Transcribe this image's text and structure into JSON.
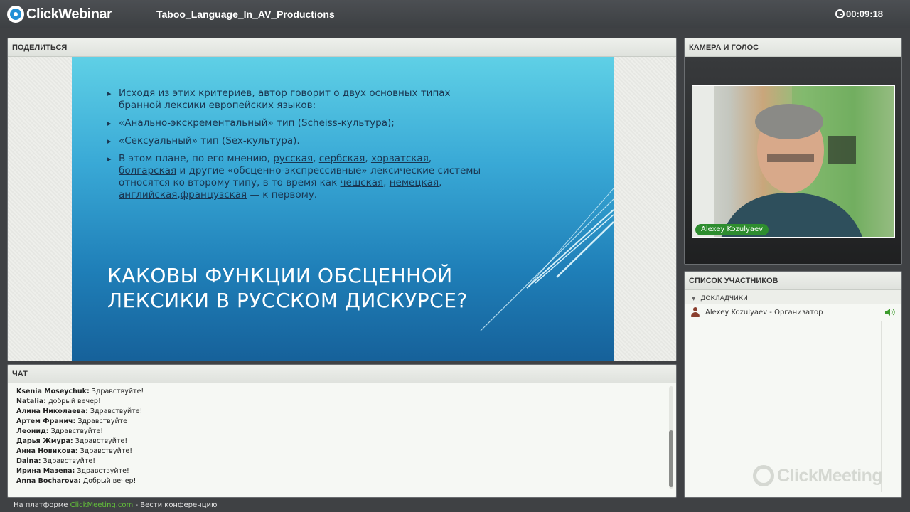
{
  "app": {
    "logo": "ClickWebinar",
    "title": "Taboo_Language_In_AV_Productions",
    "timer": "00:09:18"
  },
  "share": {
    "header": "ПОДЕЛИТЬСЯ",
    "slide": {
      "bullet1": "Исходя из этих критериев, автор говорит о двух основных типах бранной лексики европейских языков:",
      "bullet2": "«Анально-экскрементальный» тип (Scheiss-культура);",
      "bullet3": "«Сексуальный» тип (Sex-культура).",
      "bullet4": {
        "t1": "В этом плане, по его мнению, ",
        "link1": "русская",
        "sep1": ", ",
        "link2": "сербская",
        "sep2": ", ",
        "link3": "хорватская",
        "sep3": ", ",
        "link4": "болгарская",
        "t2": " и другие «обсценно-экспрессивные» лексические системы относятся ко второму типу, в то время как ",
        "link5": "чешская",
        "sep4": ", ",
        "link6": "немецкая",
        "sep5": ", ",
        "link7": "английская",
        "sep6": ",",
        "link8": "французская",
        "t3": " — к первому."
      },
      "heading": "КАКОВЫ ФУНКЦИИ ОБСЦЕННОЙ ЛЕКСИКИ В РУССКОМ ДИСКУРСЕ?"
    }
  },
  "camera": {
    "header": "КАМЕРА И ГОЛОС",
    "name_tag": "Alexey Kozulyaev"
  },
  "participants": {
    "header": "СПИСОК УЧАСТНИКОВ",
    "group": "ДОКЛАДЧИКИ",
    "items": [
      {
        "name": "Alexey Kozulyaev - Организатор"
      }
    ],
    "watermark": "ClickMeeting"
  },
  "chat": {
    "header": "ЧАТ",
    "messages": [
      {
        "author": "Ksenia Moseychuk:",
        "text": " Здравствуйте!"
      },
      {
        "author": "Natalia:",
        "text": " добрый вечер!"
      },
      {
        "author": "Алина Николаева:",
        "text": " Здравствуйте!"
      },
      {
        "author": "Артем Франич:",
        "text": " Здравствуйте"
      },
      {
        "author": "Леонид:",
        "text": " Здравствуйте!"
      },
      {
        "author": "Дарья Жмура:",
        "text": " Здравствуйте!"
      },
      {
        "author": "Анна Новикова:",
        "text": " Здравствуйте!"
      },
      {
        "author": "Daina:",
        "text": " Здравствуйте!"
      },
      {
        "author": "Ирина Мазепа:",
        "text": " Здравствуйте!"
      },
      {
        "author": "Anna Bocharova:",
        "text": " Добрый вечер!"
      }
    ]
  },
  "footer": {
    "prefix": "На платформе ",
    "link": "ClickMeeting.com",
    "suffix": " - Вести конференцию"
  },
  "colors": {
    "accent_green": "#2e8d2f",
    "link_green": "#63c23a",
    "topbar": "#3f4144"
  }
}
